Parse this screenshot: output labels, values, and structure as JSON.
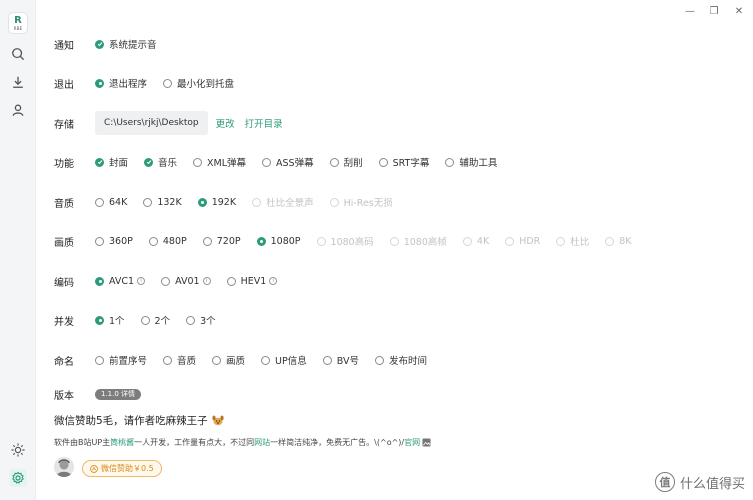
{
  "app": {
    "logo_letter": "R",
    "logo_text": "RBE"
  },
  "window": {
    "minimize": "—",
    "maximize": "❐",
    "close": "✕"
  },
  "sidebar": {
    "icons": [
      "search-icon",
      "download-icon",
      "user-icon",
      "sun-icon",
      "gear-icon"
    ]
  },
  "settings": {
    "notify": {
      "label": "通知",
      "options": [
        {
          "text": "系统提示音",
          "checked": true
        }
      ]
    },
    "exit": {
      "label": "退出",
      "options": [
        {
          "text": "退出程序",
          "checked": true
        },
        {
          "text": "最小化到托盘",
          "checked": false
        }
      ]
    },
    "storage": {
      "label": "存储",
      "path": "C:\\Users\\rjkj\\Desktop",
      "change": "更改",
      "open": "打开目录"
    },
    "features": {
      "label": "功能",
      "options": [
        {
          "text": "封面",
          "checked": true
        },
        {
          "text": "音乐",
          "checked": true
        },
        {
          "text": "XML弹幕",
          "checked": false
        },
        {
          "text": "ASS弹幕",
          "checked": false
        },
        {
          "text": "刮削",
          "checked": false
        },
        {
          "text": "SRT字幕",
          "checked": false
        },
        {
          "text": "辅助工具",
          "checked": false
        }
      ]
    },
    "audio": {
      "label": "音质",
      "options": [
        {
          "text": "64K",
          "checked": false
        },
        {
          "text": "132K",
          "checked": false
        },
        {
          "text": "192K",
          "checked": true
        },
        {
          "text": "杜比全景声",
          "disabled": true
        },
        {
          "text": "Hi-Res无损",
          "disabled": true
        }
      ]
    },
    "video": {
      "label": "画质",
      "options": [
        {
          "text": "360P",
          "checked": false
        },
        {
          "text": "480P",
          "checked": false
        },
        {
          "text": "720P",
          "checked": false
        },
        {
          "text": "1080P",
          "checked": true
        },
        {
          "text": "1080高码",
          "disabled": true
        },
        {
          "text": "1080高帧",
          "disabled": true
        },
        {
          "text": "4K",
          "disabled": true
        },
        {
          "text": "HDR",
          "disabled": true
        },
        {
          "text": "杜比",
          "disabled": true
        },
        {
          "text": "8K",
          "disabled": true
        }
      ]
    },
    "codec": {
      "label": "编码",
      "options": [
        {
          "text": "AVC1",
          "checked": true
        },
        {
          "text": "AV01",
          "checked": false
        },
        {
          "text": "HEV1",
          "checked": false
        }
      ],
      "info": "i"
    },
    "concurrency": {
      "label": "并发",
      "options": [
        {
          "text": "1个",
          "checked": true
        },
        {
          "text": "2个",
          "checked": false
        },
        {
          "text": "3个",
          "checked": false
        }
      ]
    },
    "naming": {
      "label": "命名",
      "options": [
        {
          "text": "前置序号",
          "checked": false
        },
        {
          "text": "音质",
          "checked": false
        },
        {
          "text": "画质",
          "checked": false
        },
        {
          "text": "UP信息",
          "checked": false
        },
        {
          "text": "BV号",
          "checked": false
        },
        {
          "text": "发布时间",
          "checked": false
        }
      ]
    },
    "version": {
      "label": "版本",
      "badge": "1.1.0 详情"
    }
  },
  "sponsor": {
    "title": "微信赞助5毛，请作者吃麻辣王子",
    "desc_1": "软件由B站UP主",
    "desc_author": "筒桃酱",
    "desc_2": "一人开发，工作量有点大，不过同",
    "desc_site": "网站",
    "desc_3": "一样简洁纯净，免费无广告。\\(^o^)/",
    "desc_official": "官网",
    "button": "微信赞助￥0.5"
  },
  "watermark": {
    "logo": "值",
    "text": "什么值得买"
  },
  "colors": {
    "accent": "#2e9a7c",
    "sponsor": "#d98a1d"
  }
}
